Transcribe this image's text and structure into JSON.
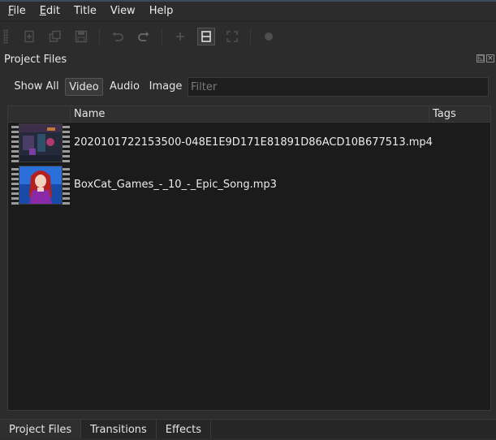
{
  "menu": {
    "items": [
      {
        "label": "File",
        "mnemonic": "F",
        "rest": "ile"
      },
      {
        "label": "Edit",
        "mnemonic": "E",
        "rest": "dit"
      },
      {
        "label": "Title",
        "mnemonic": "",
        "rest": "Title"
      },
      {
        "label": "View",
        "mnemonic": "",
        "rest": "View"
      },
      {
        "label": "Help",
        "mnemonic": "",
        "rest": "Help"
      }
    ]
  },
  "toolbar": {
    "icons": [
      "new-project-icon",
      "open-project-icon",
      "save-project-icon",
      "undo-icon",
      "redo-icon",
      "add-track-icon",
      "film-view-icon",
      "fullscreen-icon",
      "record-icon"
    ]
  },
  "dock": {
    "title": "Project Files"
  },
  "filter": {
    "tabs": [
      "Show All",
      "Video",
      "Audio",
      "Image"
    ],
    "active": "Video",
    "placeholder": "Filter",
    "value": ""
  },
  "files": {
    "columns": [
      "",
      "Name",
      "Tags"
    ],
    "rows": [
      {
        "name": "2020101722153500-048E1E9D171E81891D86ACD10B677513.mp4",
        "tags": "",
        "thumb": "video-thumbnail"
      },
      {
        "name": "BoxCat_Games_-_10_-_Epic_Song.mp3",
        "tags": "",
        "thumb": "anime-girl-thumbnail"
      }
    ]
  },
  "bottom_tabs": {
    "items": [
      "Project Files",
      "Transitions",
      "Effects"
    ],
    "active": "Project Files"
  },
  "colors": {
    "background": "#2c2c2c",
    "panel": "#1b1b1b",
    "text": "#e6e6e6"
  }
}
